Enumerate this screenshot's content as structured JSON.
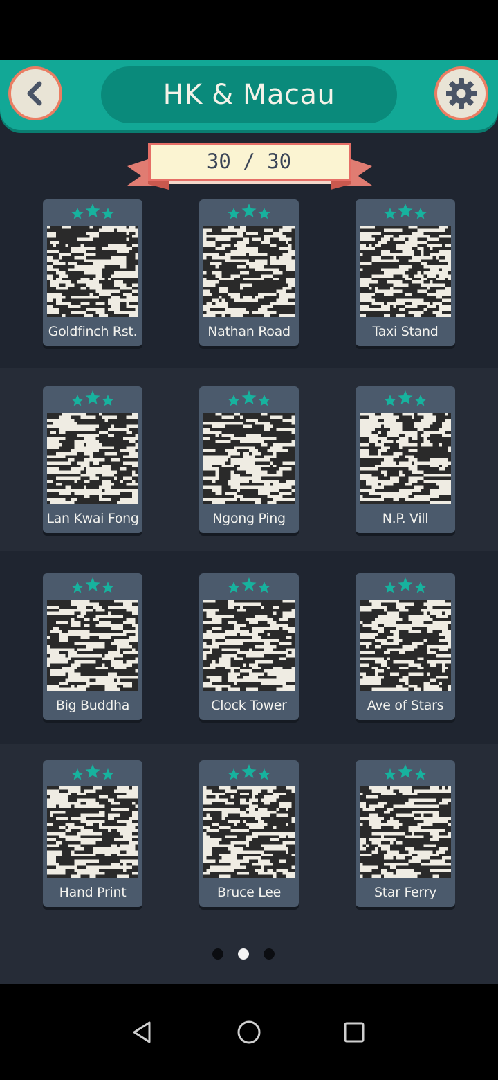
{
  "header": {
    "title": "HK & Macau",
    "back_icon": "chevron-left-icon",
    "settings_icon": "gear-icon"
  },
  "progress": {
    "label": "30 / 30",
    "completed": 30,
    "total": 30
  },
  "levels": [
    {
      "label": "Goldfinch Rst.",
      "stars": 3
    },
    {
      "label": "Nathan Road",
      "stars": 3
    },
    {
      "label": "Taxi Stand",
      "stars": 3
    },
    {
      "label": "Lan Kwai Fong",
      "stars": 3
    },
    {
      "label": "Ngong Ping",
      "stars": 3
    },
    {
      "label": "N.P. Vill",
      "stars": 3
    },
    {
      "label": "Big Buddha",
      "stars": 3
    },
    {
      "label": "Clock Tower",
      "stars": 3
    },
    {
      "label": "Ave of Stars",
      "stars": 3
    },
    {
      "label": "Hand Print",
      "stars": 3
    },
    {
      "label": "Bruce Lee",
      "stars": 3
    },
    {
      "label": "Star Ferry",
      "stars": 3
    }
  ],
  "pagination": {
    "pages": 3,
    "current": 2
  },
  "nav": {
    "back_icon": "triangle-back-icon",
    "home_icon": "circle-home-icon",
    "recents_icon": "square-recents-icon"
  },
  "colors": {
    "accent": "#12a896",
    "accent_dark": "#0a8a7b",
    "star": "#17b29e",
    "button_ring": "#ea7d63",
    "card": "#4b5a6c",
    "background": "#1f2530"
  }
}
